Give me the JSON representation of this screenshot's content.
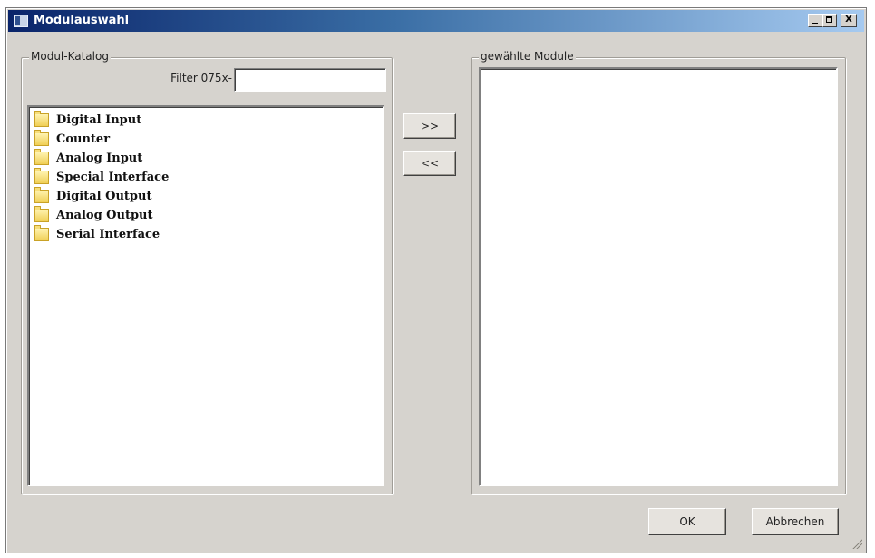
{
  "window": {
    "title": "Modulauswahl",
    "controls": {
      "minimize": "_",
      "maximize": "□",
      "close": "X"
    }
  },
  "catalog": {
    "group_label": "Modul-Katalog",
    "filter_label": "Filter  075x-",
    "filter_value": "",
    "items": [
      {
        "label": "Digital Input",
        "icon": "folder-icon"
      },
      {
        "label": "Counter",
        "icon": "folder-icon"
      },
      {
        "label": "Analog Input",
        "icon": "folder-icon"
      },
      {
        "label": "Special Interface",
        "icon": "folder-icon"
      },
      {
        "label": "Digital Output",
        "icon": "folder-icon"
      },
      {
        "label": "Analog Output",
        "icon": "folder-icon"
      },
      {
        "label": "Serial Interface",
        "icon": "folder-icon"
      }
    ]
  },
  "transfer": {
    "add_label": ">>",
    "remove_label": "<<"
  },
  "selected": {
    "group_label": "gewählte Module",
    "items": []
  },
  "footer": {
    "ok_label": "OK",
    "cancel_label": "Abbrechen"
  },
  "colors": {
    "titlebar_start": "#0a246a",
    "titlebar_end": "#a6caf0",
    "dialog_bg": "#d6d3ce"
  }
}
